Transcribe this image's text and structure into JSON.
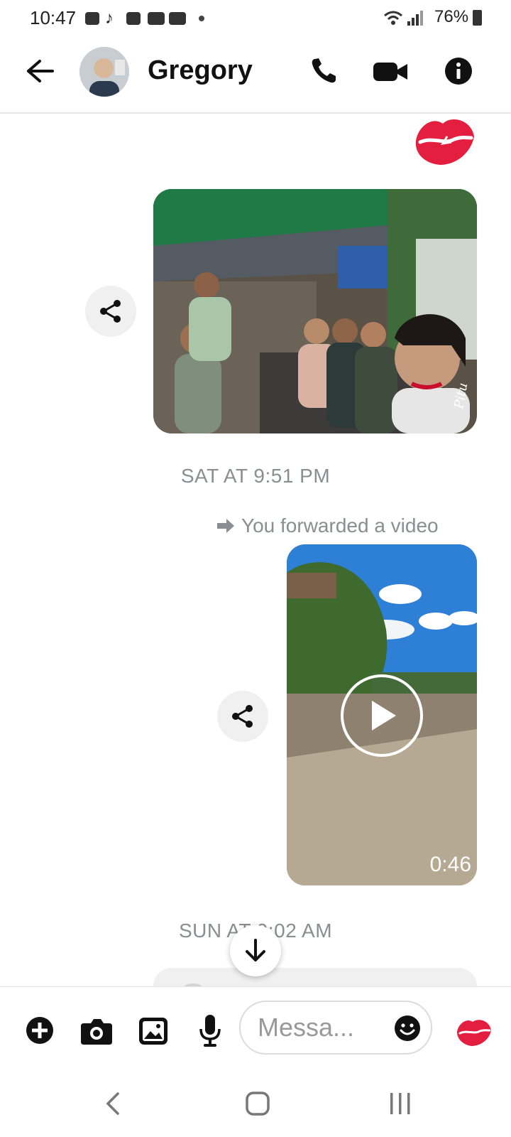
{
  "status_bar": {
    "time": "10:47",
    "battery": "76%",
    "icons": [
      "shopping-bag-icon",
      "tiktok-icon",
      "folder-icon",
      "youtube-icon",
      "youtube-icon",
      "dot-icon",
      "wifi-icon",
      "signal-icon",
      "battery-icon"
    ]
  },
  "header": {
    "contact_name": "Gregory",
    "icons": [
      "back-arrow-icon",
      "phone-icon",
      "video-camera-icon",
      "info-icon"
    ]
  },
  "messages": {
    "reaction_top": "kiss-lips",
    "photo_watermark": "Pitu",
    "sep_saturday": "SAT AT 9:51 PM",
    "forwarded_label": "You forwarded a video",
    "video_duration": "0:46",
    "sep_sunday": "SUN AT 9:02 AM"
  },
  "composer": {
    "placeholder": "Messa...",
    "icons": [
      "plus-icon",
      "camera-icon",
      "gallery-icon",
      "microphone-icon",
      "emoji-icon",
      "kiss-lips-icon"
    ]
  },
  "colors": {
    "accent": "#e41e3f",
    "text_secondary": "#8a8d91",
    "share_bg": "#f0f0f0"
  }
}
